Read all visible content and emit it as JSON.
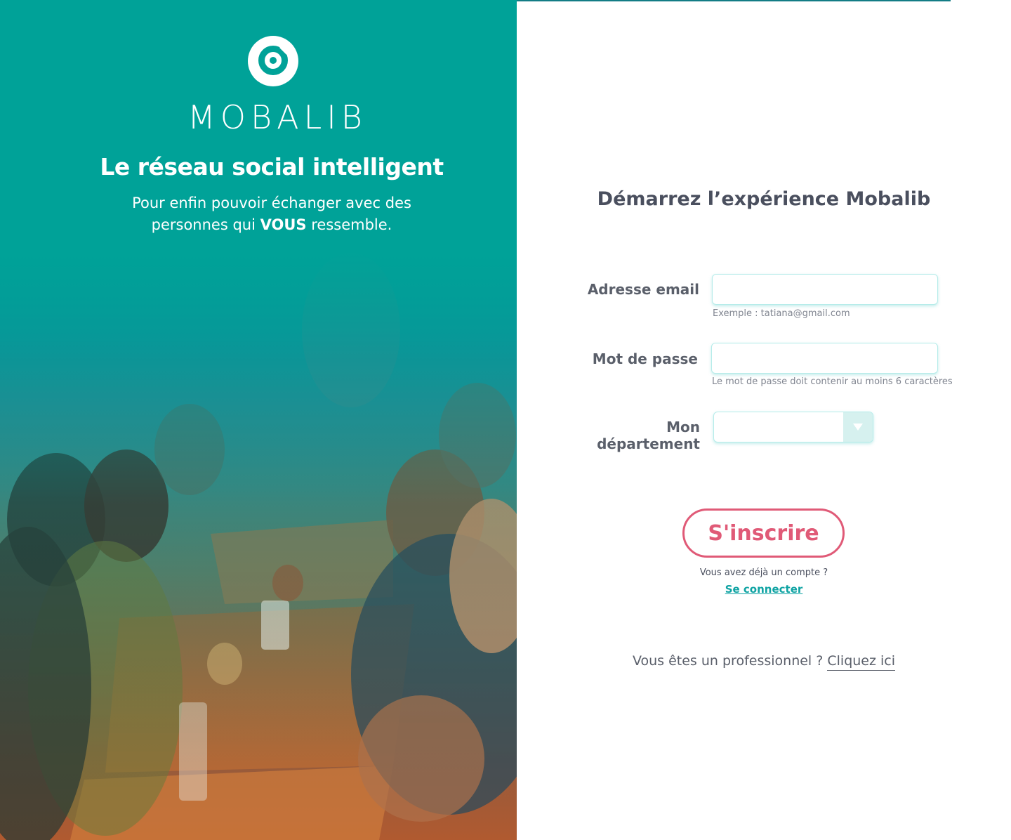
{
  "hero": {
    "brand": "MOBALIB",
    "tagline": "Le réseau social intelligent",
    "subtitle_before": "Pour enfin pouvoir échanger avec des personnes qui",
    "subtitle_strong": "VOUS",
    "subtitle_after": "ressemble.",
    "accent_color": "#00a298"
  },
  "form": {
    "title": "Démarrez  l’expérience Mobalib",
    "email": {
      "label": "Adresse email",
      "value": "",
      "placeholder": "",
      "hint": "Exemple : tatiana@gmail.com"
    },
    "password": {
      "label": "Mot de passe",
      "value": "",
      "placeholder": "",
      "hint": "Le mot de passe doit contenir au moins 6 caractères"
    },
    "department": {
      "label": "Mon département",
      "selected": ""
    },
    "submit_label": "S'inscrire",
    "submit_color": "#e05a77",
    "have_account": "Vous avez déjà un compte ?",
    "login_link": "Se connecter",
    "pro_text": "Vous êtes un professionnel ?",
    "pro_link": "Cliquez ici"
  }
}
